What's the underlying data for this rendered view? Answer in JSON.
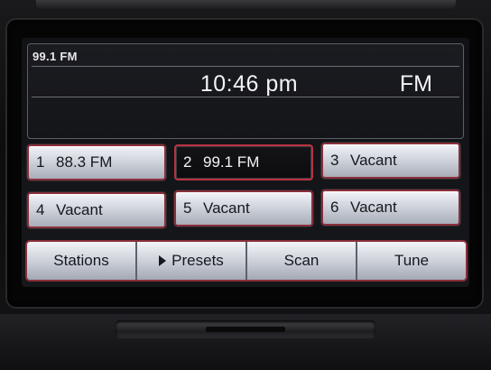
{
  "info": {
    "station": "99.1 FM",
    "time": "10:46 pm",
    "band": "FM"
  },
  "presets": [
    {
      "num": "1",
      "label": "88.3 FM",
      "active": false
    },
    {
      "num": "2",
      "label": "99.1 FM",
      "active": true
    },
    {
      "num": "3",
      "label": "Vacant",
      "active": false
    },
    {
      "num": "4",
      "label": "Vacant",
      "active": false
    },
    {
      "num": "5",
      "label": "Vacant",
      "active": false
    },
    {
      "num": "6",
      "label": "Vacant",
      "active": false
    }
  ],
  "softkeys": {
    "stations": "Stations",
    "presets": "Presets",
    "scan": "Scan",
    "tune": "Tune"
  },
  "colors": {
    "button_border_accent": "#8a2f3a",
    "active_border": "#b8323f",
    "screen_bg": "#131418"
  },
  "icons": {
    "presets_marker": "play-triangle-icon"
  }
}
